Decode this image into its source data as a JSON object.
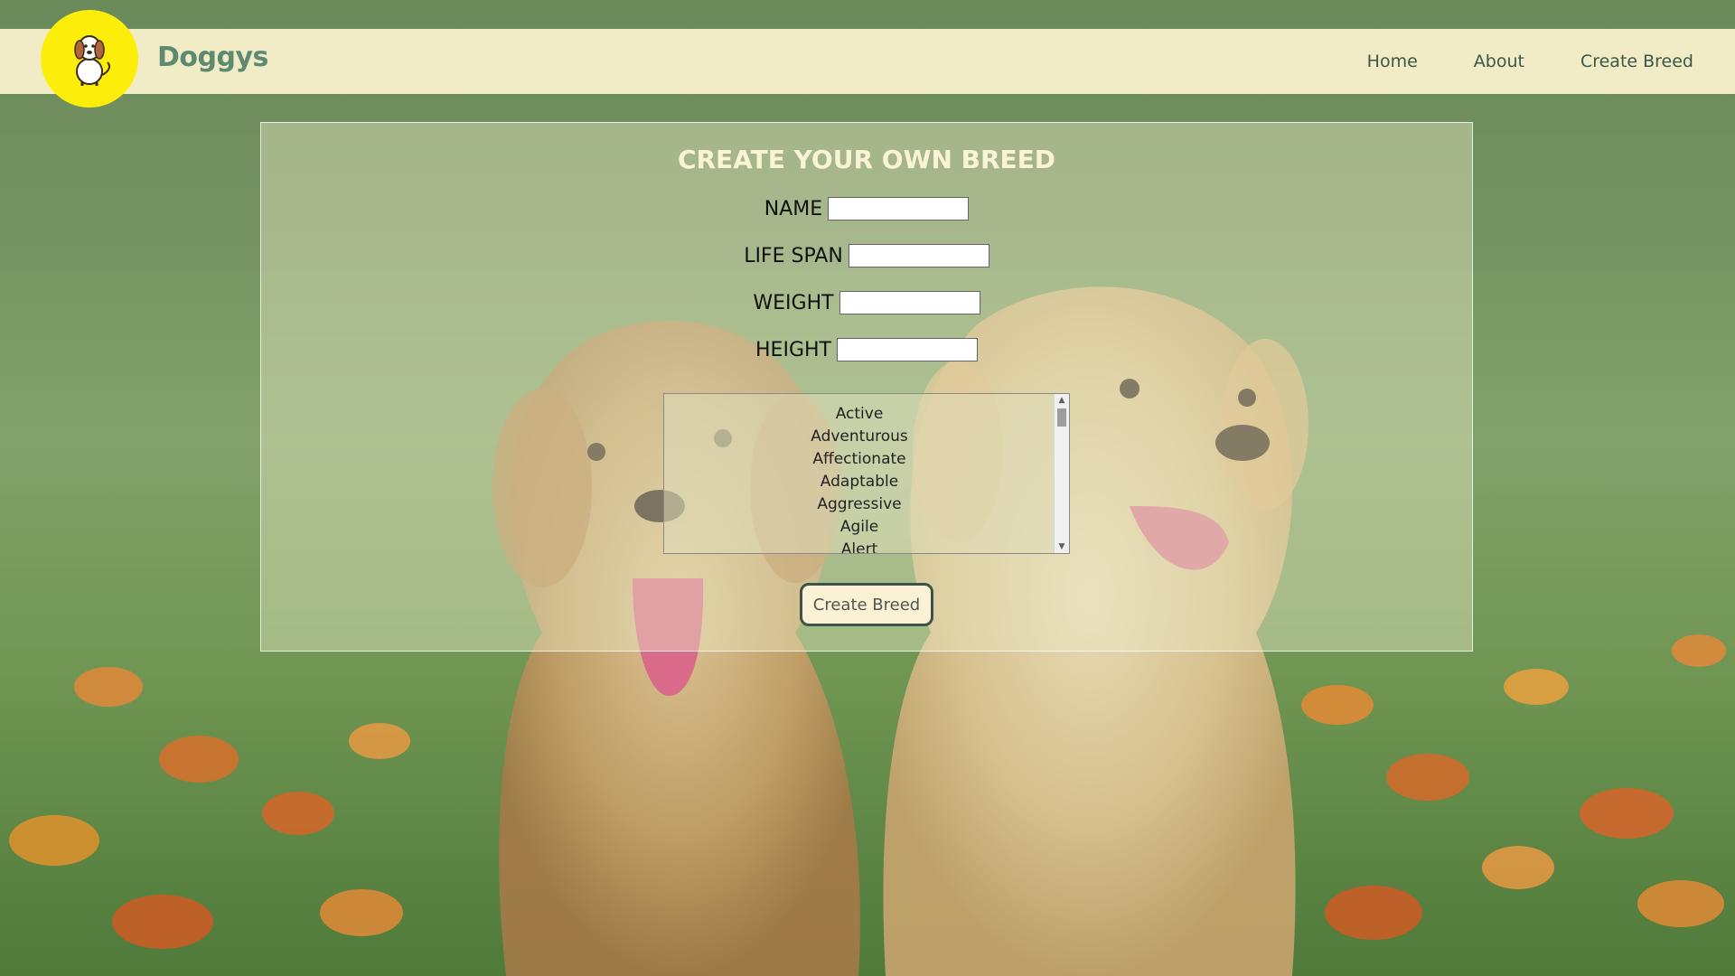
{
  "brand": {
    "name": "Doggys",
    "logo_icon": "dog-icon",
    "logo_color": "#fcee0a"
  },
  "nav": {
    "items": [
      {
        "label": "Home"
      },
      {
        "label": "About"
      },
      {
        "label": "Create Breed"
      }
    ]
  },
  "form": {
    "title": "CREATE YOUR OWN BREED",
    "fields": [
      {
        "label": "NAME",
        "value": "",
        "placeholder": ""
      },
      {
        "label": "LIFE SPAN",
        "value": "",
        "placeholder": ""
      },
      {
        "label": "WEIGHT",
        "value": "",
        "placeholder": ""
      },
      {
        "label": "HEIGHT",
        "value": "",
        "placeholder": ""
      }
    ],
    "temperaments": [
      "Active",
      "Adventurous",
      "Affectionate",
      "Adaptable",
      "Aggressive",
      "Agile",
      "Alert"
    ],
    "submit_label": "Create Breed"
  },
  "colors": {
    "navbar_bg": "#f1ecc5",
    "brand_text": "#5e8a72",
    "title_text": "#fbf4d4",
    "button_border": "#3d5248"
  }
}
